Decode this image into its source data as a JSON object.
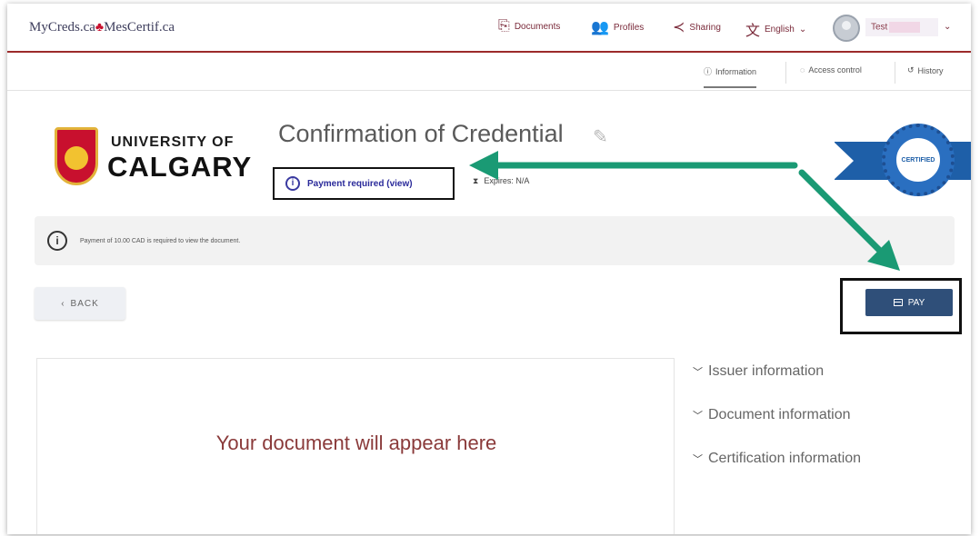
{
  "header": {
    "brand_left": "MyCreds.ca",
    "brand_leaf": "♣",
    "brand_right": "MesCertif.ca",
    "nav": [
      {
        "label": "Documents",
        "icon": "document-icon"
      },
      {
        "label": "Profiles",
        "icon": "profiles-icon"
      },
      {
        "label": "Sharing",
        "icon": "share-icon"
      },
      {
        "label": "English",
        "icon": "language-icon"
      }
    ],
    "user_name": "Test"
  },
  "subtabs": [
    {
      "label": "Information",
      "glyph": "ⓘ"
    },
    {
      "label": "Access control",
      "glyph": "◌"
    },
    {
      "label": "History",
      "glyph": "↺"
    }
  ],
  "institution": {
    "line1": "UNIVERSITY OF",
    "line2": "CALGARY"
  },
  "document": {
    "title": "Confirmation of Credential",
    "payment_status": "Payment required (view)",
    "expires": "Expires: N/A",
    "badge_text": "CERTIFIED"
  },
  "notice": {
    "message": "Payment of 10.00 CAD is required to view the document."
  },
  "actions": {
    "back_label": "BACK",
    "pay_label": "PAY"
  },
  "viewer": {
    "placeholder": "Your document will appear here"
  },
  "side_sections": [
    {
      "label": "Issuer information"
    },
    {
      "label": "Document information"
    },
    {
      "label": "Certification information"
    }
  ],
  "colors": {
    "accent": "#9c2a2a",
    "pay_button": "#2f4f79",
    "arrow": "#1a9a74",
    "badge": "#1e5fa8"
  }
}
